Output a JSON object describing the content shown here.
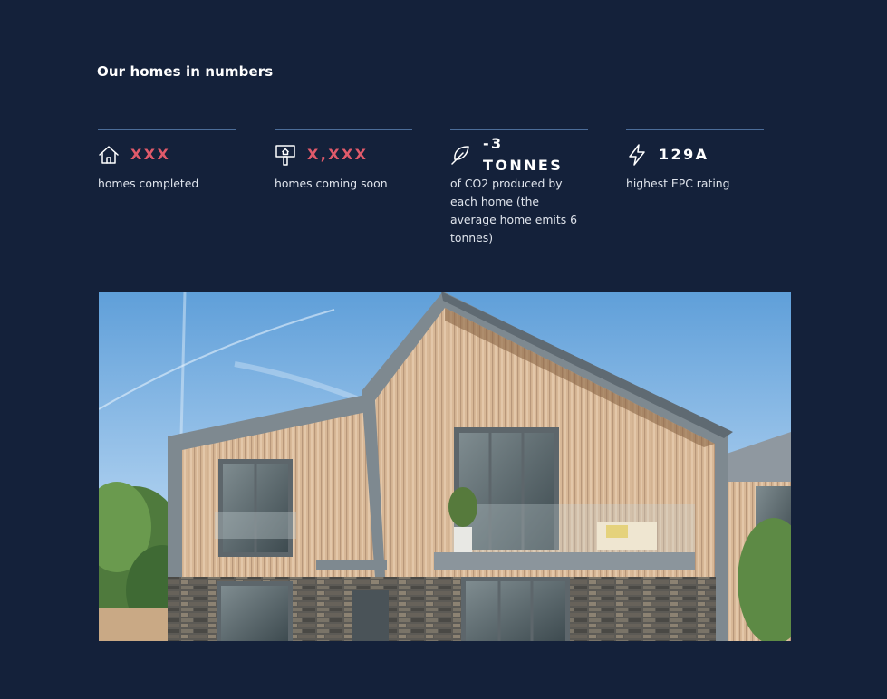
{
  "section": {
    "title": "Our homes in numbers"
  },
  "stats": [
    {
      "icon": "house-icon",
      "value": "XXX",
      "desc": "homes completed",
      "value_color": "#e05a6a"
    },
    {
      "icon": "signpost-icon",
      "value": "X,XXX",
      "desc": "homes coming soon",
      "value_color": "#e05a6a"
    },
    {
      "icon": "leaf-icon",
      "value": "-3 TONNES",
      "desc": "of CO2 produced by each home (the average home emits 6 tonnes)",
      "value_color": "#ffffff"
    },
    {
      "icon": "lightning-icon",
      "value": "129A",
      "desc": "highest EPC rating",
      "value_color": "#ffffff"
    }
  ],
  "colors": {
    "background": "#14213a",
    "divider": "#4c6d99",
    "accent": "#e05a6a"
  }
}
